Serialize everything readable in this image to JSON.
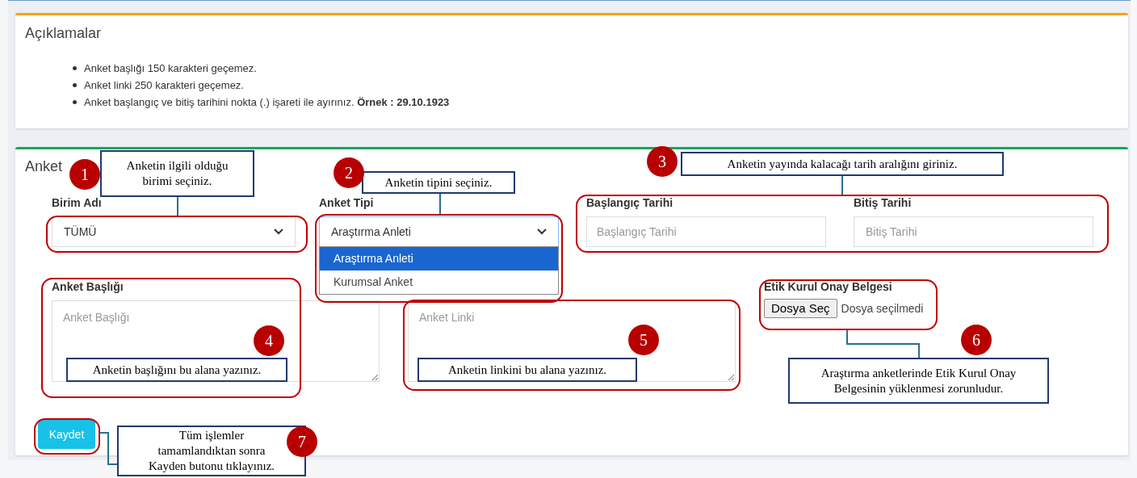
{
  "notes_card": {
    "title": "Açıklamalar",
    "items": [
      "Anket başlığı 150 karakteri geçemez.",
      "Anket linki 250 karakteri geçemez.",
      "Anket başlangıç ve bitiş tarihini nokta (.) işareti ile ayırınız. **Örnek : 29.10.1923**"
    ]
  },
  "form": {
    "title": "Anket",
    "unit": {
      "label": "Birim Adı",
      "value": "TÜMÜ"
    },
    "type": {
      "label": "Anket Tipi",
      "value": "Araştırma Anleti",
      "expanded": true,
      "options": [
        {
          "label": "Araştırma Anleti",
          "selected": true
        },
        {
          "label": "Kurumsal Anket",
          "selected": false
        }
      ]
    },
    "start_date": {
      "label": "Başlangıç Tarihi",
      "placeholder": "Başlangıç Tarihi"
    },
    "end_date": {
      "label": "Bitiş Tarihi",
      "placeholder": "Bitiş Tarihi"
    },
    "title_field": {
      "label": "Anket Başlığı",
      "placeholder": "Anket Başlığı"
    },
    "link_field": {
      "placeholder": "Anket Linki"
    },
    "ethics_file": {
      "label": "Etik Kurul Onay Belgesi",
      "button": "Dosya Seç",
      "status": "Dosya seçilmedi"
    },
    "save_button": "Kaydet"
  },
  "annotations": [
    {
      "number": "1",
      "text": "Anketin ilgili olduğu birimi seçiniz."
    },
    {
      "number": "2",
      "text": "Anketin tipini seçiniz."
    },
    {
      "number": "3",
      "text": "Anketin yayında kalacağı tarih aralığını giriniz."
    },
    {
      "number": "4",
      "text": "Anketin başlığını bu alana yazınız."
    },
    {
      "number": "5",
      "text": "Anketin linkini bu alana yazınız."
    },
    {
      "number": "6",
      "text": "Araştırma anketlerinde Etik Kurul Onay Belgesinin yüklenmesi zorunludur."
    },
    {
      "number": "7",
      "text": "Tüm işlemler tamamlandıktan sonra Kayden butonu tıklayınız."
    }
  ]
}
